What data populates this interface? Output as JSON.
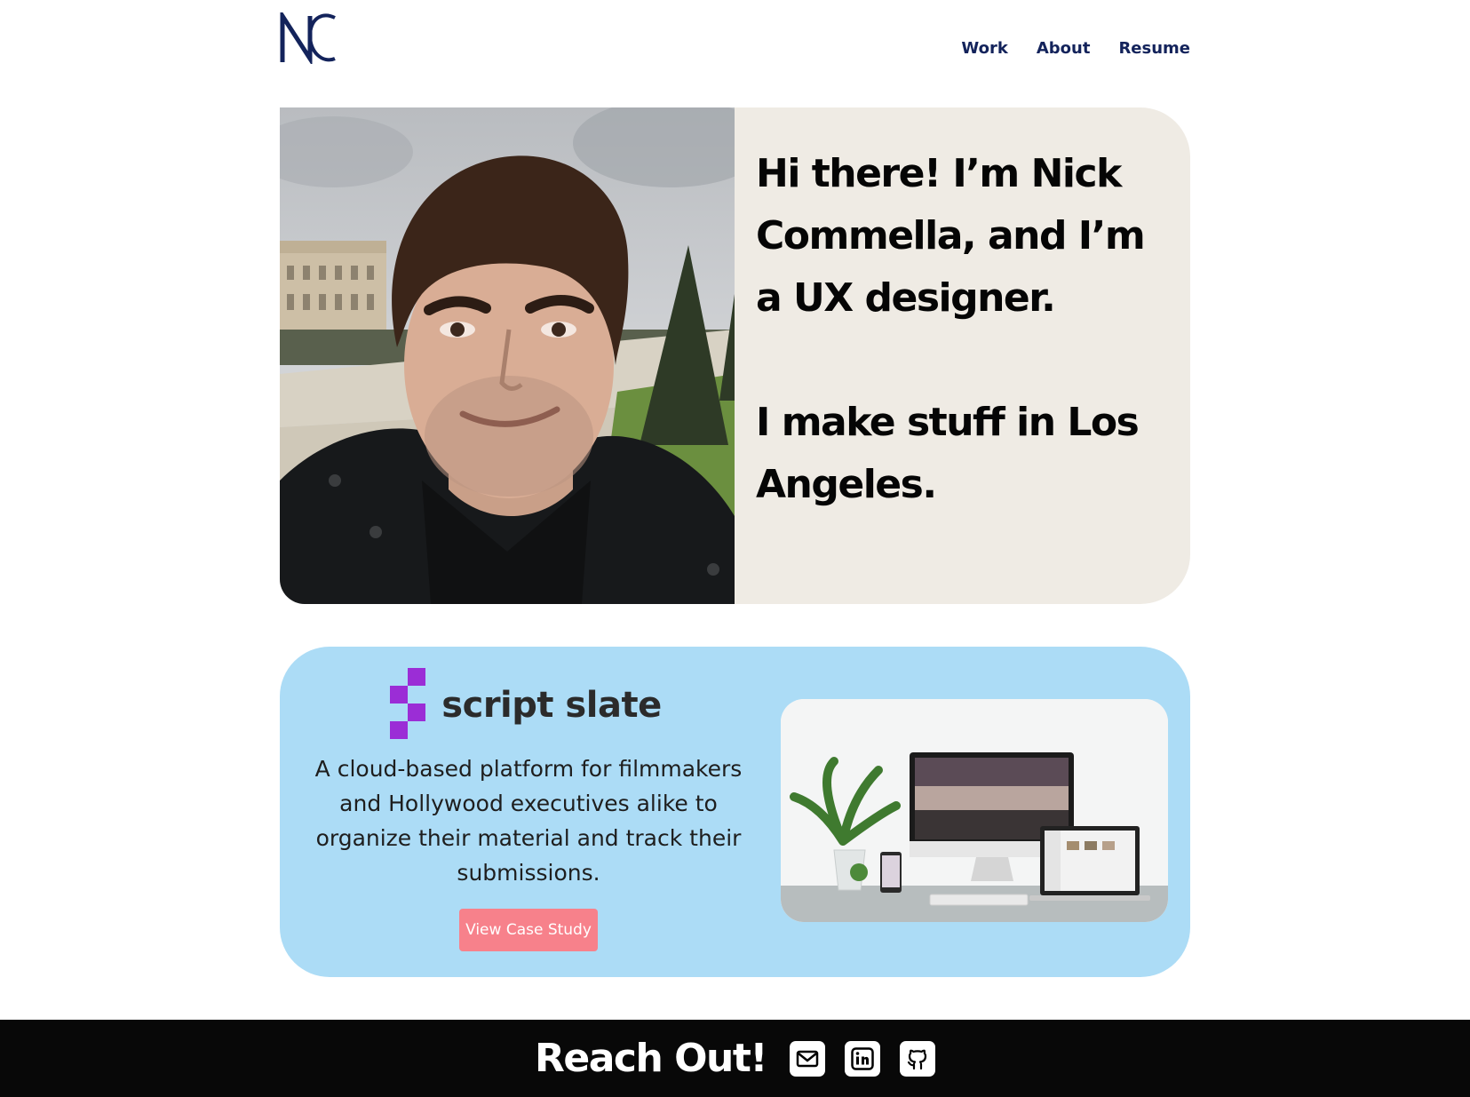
{
  "header": {
    "logo_icon": "nc-monogram-logo",
    "nav": [
      {
        "label": "Work"
      },
      {
        "label": "About"
      },
      {
        "label": "Resume"
      }
    ]
  },
  "hero": {
    "photo_icon": "portrait-photo",
    "line1": "Hi there! I’m Nick Commella, and I’m a UX designer.",
    "line2": "I make stuff in Los Angeles."
  },
  "project": {
    "brand_icon": "script-slate-logo-mark",
    "name": "script slate",
    "description": "A cloud-based platform for filmmakers and Hollywood executives alike to organize their material and track their submissions.",
    "cta_label": "View Case Study",
    "mockup_icon": "device-mockup-image",
    "colors": {
      "card": "#acdcf6",
      "brand": "#9b2dd6",
      "cta": "#f7818b"
    }
  },
  "footer": {
    "title": "Reach Out!",
    "links": [
      {
        "icon": "email-icon"
      },
      {
        "icon": "linkedin-icon"
      },
      {
        "icon": "github-icon"
      }
    ]
  }
}
